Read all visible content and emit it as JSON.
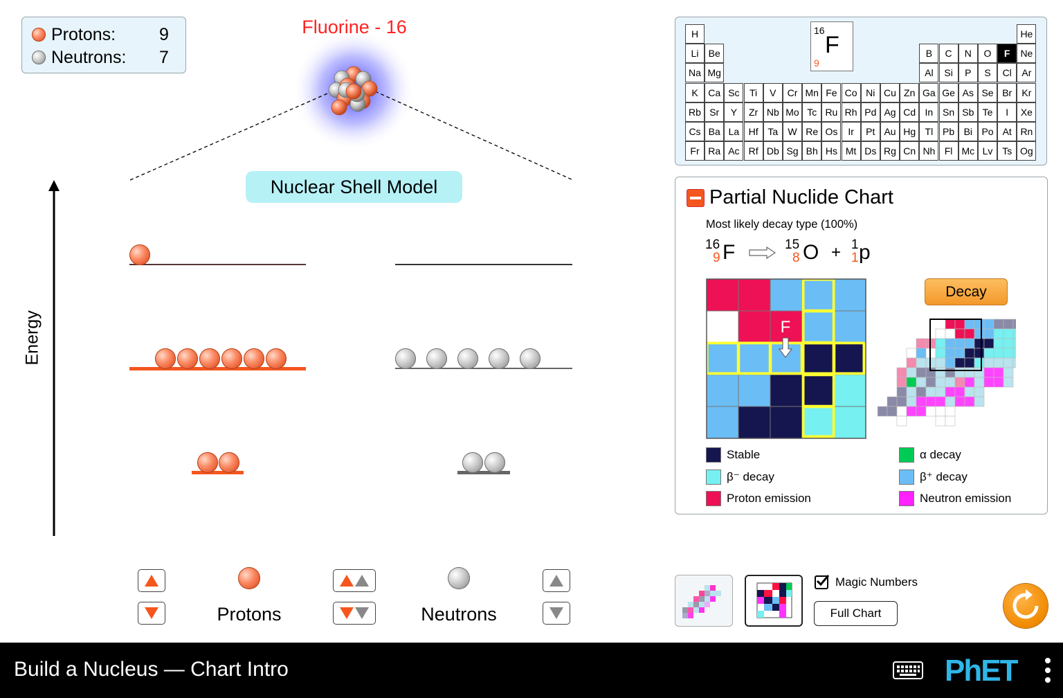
{
  "counts": {
    "protons_label": "Protons:",
    "protons": "9",
    "neutrons_label": "Neutrons:",
    "neutrons": "7"
  },
  "element_name": "Fluorine - 16",
  "shell_model_label": "Nuclear Shell Model",
  "energy_label": "Energy",
  "shells": {
    "protons": [
      2,
      6,
      1
    ],
    "neutrons": [
      2,
      5,
      0
    ]
  },
  "controls": {
    "protons_label": "Protons",
    "neutrons_label": "Neutrons"
  },
  "periodic_table": {
    "selected": "F",
    "big_symbol": "F",
    "big_mass": "16",
    "big_number": "9",
    "rows": [
      [
        "H",
        "",
        "",
        "",
        "",
        "",
        "",
        "",
        "",
        "",
        "",
        "",
        "",
        "",
        "",
        "",
        "",
        "He"
      ],
      [
        "Li",
        "Be",
        "",
        "",
        "",
        "",
        "",
        "",
        "",
        "",
        "",
        "",
        "B",
        "C",
        "N",
        "O",
        "F",
        "Ne"
      ],
      [
        "Na",
        "Mg",
        "",
        "",
        "",
        "",
        "",
        "",
        "",
        "",
        "",
        "",
        "Al",
        "Si",
        "P",
        "S",
        "Cl",
        "Ar"
      ],
      [
        "K",
        "Ca",
        "Sc",
        "Ti",
        "V",
        "Cr",
        "Mn",
        "Fe",
        "Co",
        "Ni",
        "Cu",
        "Zn",
        "Ga",
        "Ge",
        "As",
        "Se",
        "Br",
        "Kr"
      ],
      [
        "Rb",
        "Sr",
        "Y",
        "Zr",
        "Nb",
        "Mo",
        "Tc",
        "Ru",
        "Rh",
        "Pd",
        "Ag",
        "Cd",
        "In",
        "Sn",
        "Sb",
        "Te",
        "I",
        "Xe"
      ],
      [
        "Cs",
        "Ba",
        "La",
        "Hf",
        "Ta",
        "W",
        "Re",
        "Os",
        "Ir",
        "Pt",
        "Au",
        "Hg",
        "Tl",
        "Pb",
        "Bi",
        "Po",
        "At",
        "Rn"
      ],
      [
        "Fr",
        "Ra",
        "Ac",
        "Rf",
        "Db",
        "Sg",
        "Bh",
        "Hs",
        "Mt",
        "Ds",
        "Rg",
        "Cn",
        "Nh",
        "Fl",
        "Mc",
        "Lv",
        "Ts",
        "Og"
      ]
    ]
  },
  "nuclide_chart": {
    "title": "Partial Nuclide Chart",
    "decay_type": "Most likely decay type  (100%)",
    "equation": {
      "parent_mass": "16",
      "parent_z": "9",
      "parent": "F",
      "daughter_mass": "15",
      "daughter_z": "8",
      "daughter": "O",
      "plus": "+",
      "product_mass": "1",
      "product_z": "1",
      "product": "p"
    },
    "grid_colors": [
      [
        "#ee1155",
        "#ee1155",
        "#6bbdf5",
        "#6bbdf5",
        "#6bbdf5"
      ],
      [
        "#ffffff",
        "#ee1155",
        "#ee1155",
        "#6bbdf5",
        "#6bbdf5"
      ],
      [
        "#6bbdf5",
        "#6bbdf5",
        "#6bbdf5",
        "#15154f",
        "#15154f"
      ],
      [
        "#6bbdf5",
        "#6bbdf5",
        "#15154f",
        "#15154f",
        "#76f0f0"
      ],
      [
        "#6bbdf5",
        "#15154f",
        "#15154f",
        "#76f0f0",
        "#76f0f0"
      ]
    ],
    "current_label": "F",
    "decay_button": "Decay",
    "legend": [
      {
        "label": "Stable",
        "color": "#15154f"
      },
      {
        "label": "α decay",
        "color": "#00cc55"
      },
      {
        "label": "β⁻ decay",
        "color": "#76f0f0"
      },
      {
        "label": "β⁺ decay",
        "color": "#6bbdf5"
      },
      {
        "label": "Proton emission",
        "color": "#ee1155"
      },
      {
        "label": "Neutron emission",
        "color": "#ff22ff"
      }
    ]
  },
  "magic_numbers_label": "Magic Numbers",
  "magic_numbers_checked": true,
  "full_chart_button": "Full Chart",
  "navbar": {
    "title": "Build a Nucleus — Chart Intro",
    "brand": "PhET"
  }
}
